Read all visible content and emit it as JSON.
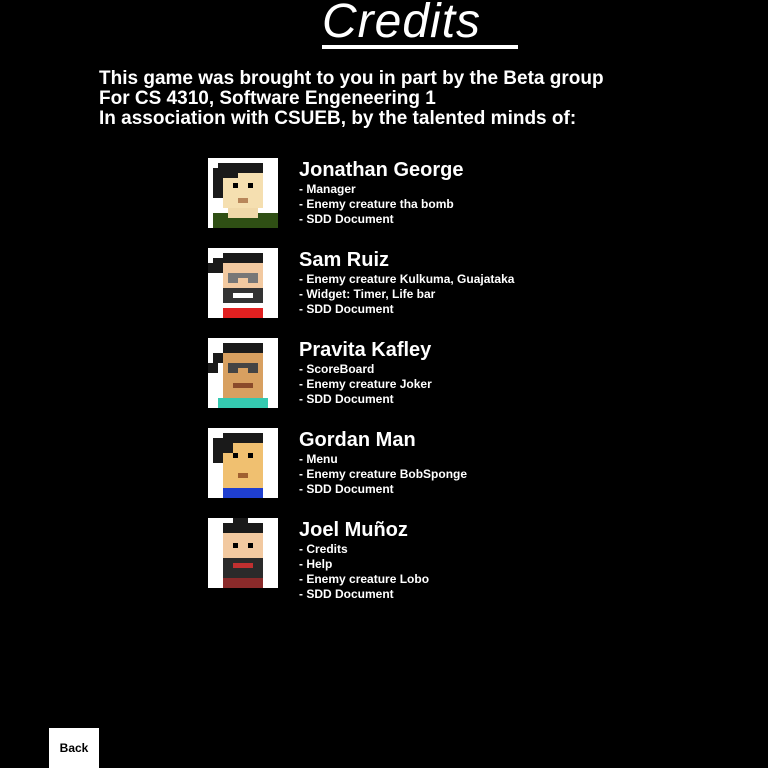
{
  "title": "Credits",
  "intro": [
    "This game was brought to you in part by the Beta group",
    "For CS 4310, Software Engeneering 1",
    "In association with CSUEB, by the talented minds of:"
  ],
  "members": [
    {
      "name": "Jonathan George",
      "roles": [
        "- Manager",
        "- Enemy creature tha bomb",
        "- SDD Document"
      ]
    },
    {
      "name": "Sam Ruiz",
      "roles": [
        "- Enemy creature Kulkuma, Guajataka",
        "- Widget: Timer, Life bar",
        "- SDD Document"
      ]
    },
    {
      "name": "Pravita Kafley",
      "roles": [
        "- ScoreBoard",
        "- Enemy creature Joker",
        "- SDD Document"
      ]
    },
    {
      "name": "Gordan Man",
      "roles": [
        "- Menu",
        "- Enemy creature BobSponge",
        "- SDD Document"
      ]
    },
    {
      "name": "Joel Muñoz",
      "roles": [
        "- Credits",
        "- Help",
        "- Enemy creature Lobo",
        "- SDD Document"
      ]
    }
  ],
  "back_label": "Back",
  "colors": {
    "background": "#000000",
    "text": "#ffffff",
    "button": "#ffffff"
  }
}
